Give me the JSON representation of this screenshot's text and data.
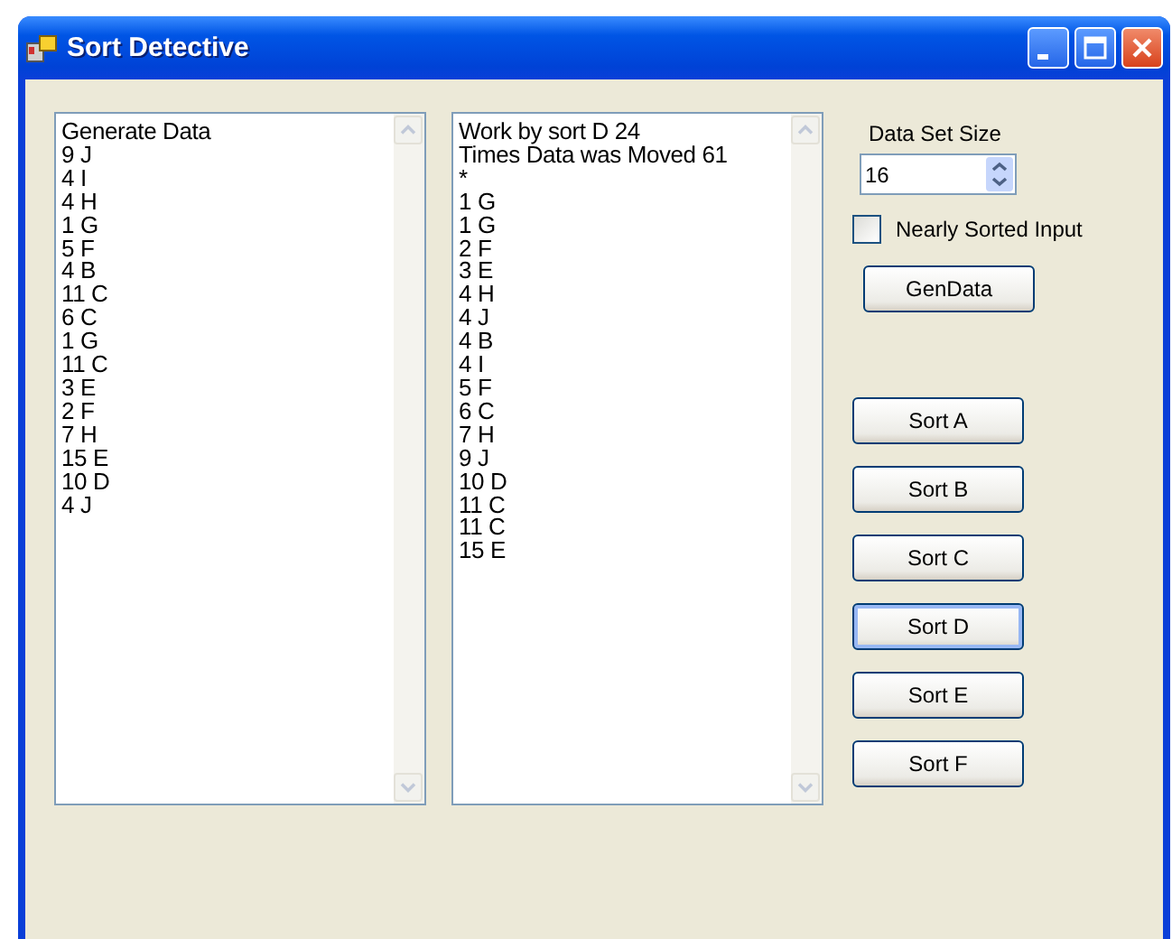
{
  "window": {
    "title": "Sort Detective"
  },
  "input_list": {
    "lines": [
      "Generate Data",
      "9 J",
      "4 I",
      "4 H",
      "1 G",
      "5 F",
      "4 B",
      "11 C",
      "6 C",
      "1 G",
      "11 C",
      "3 E",
      "2 F",
      "7 H",
      "15 E",
      "10 D",
      "4 J"
    ]
  },
  "output_list": {
    "lines": [
      "Work by sort D 24",
      "Times Data was Moved 61",
      "*",
      "1 G",
      "1 G",
      "2 F",
      "3 E",
      "4 H",
      "4 J",
      "4 B",
      "4 I",
      "5 F",
      "6 C",
      "7 H",
      "9 J",
      "10 D",
      "11 C",
      "11 C",
      "15 E"
    ]
  },
  "data_set_size": {
    "label": "Data Set Size",
    "value": "16"
  },
  "nearly_sorted": {
    "label": "Nearly Sorted Input",
    "checked": false
  },
  "gen_button": {
    "label": "GenData"
  },
  "sort_buttons": [
    {
      "label": "Sort A",
      "focused": false
    },
    {
      "label": "Sort B",
      "focused": false
    },
    {
      "label": "Sort C",
      "focused": false
    },
    {
      "label": "Sort D",
      "focused": true
    },
    {
      "label": "Sort E",
      "focused": false
    },
    {
      "label": "Sort F",
      "focused": false
    }
  ]
}
